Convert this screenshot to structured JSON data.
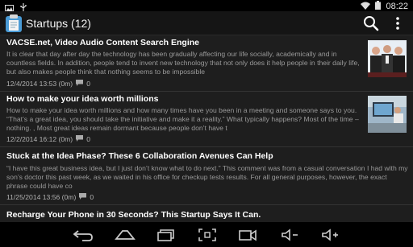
{
  "status_bar": {
    "time": "08:22",
    "left_icons": [
      "image-icon",
      "usb-icon"
    ],
    "right_icons": [
      "wifi-icon",
      "battery-icon"
    ]
  },
  "action_bar": {
    "title": "Startups (12)",
    "icons": [
      "app-logo-icon",
      "search-icon",
      "overflow-menu-icon"
    ]
  },
  "articles": [
    {
      "title": "VACSE.net, Video Audio Content Search Engine",
      "excerpt": "It is clear that day after day the technology has been gradually affecting our life socially, academically and in countless fields. In addition, people tend to invent new technology that not only does it help people in their daily life, but also makes people think that nothing seems to be impossible",
      "date": "12/4/2014 13:53 (0m)",
      "comments": "0",
      "thumbnail": "group-photo-thumbnail"
    },
    {
      "title": "How to make your idea worth millions",
      "excerpt": "How to make your idea worth millions and how many times have you been in a meeting and someone says to you. “That’s a great idea, you should take the initiative and make it a reality.” What typically happens? Most of the time – nothing. , Most great ideas remain dormant because people don’t have t",
      "date": "12/2/2014 16:12 (0m)",
      "comments": "0",
      "thumbnail": "office-thumbnail"
    },
    {
      "title": "Stuck at the Idea Phase? These 6 Collaboration Avenues Can Help",
      "excerpt": "“I have this great business idea, but I just don’t know what to do next.” This comment was from a casual conversation I had with my son’s doctor this past week, as we waited in his office for checkup tests results. For all general purposes, however, the exact phrase could have co",
      "date": "11/25/2014 13:56 (0m)",
      "comments": "0"
    },
    {
      "title": "Recharge Your Phone in 30 Seconds? This Startup Says It Can."
    }
  ],
  "nav_bar": {
    "buttons": [
      "back-icon",
      "home-icon",
      "recents-icon",
      "screenshot-icon",
      "camera-icon",
      "volume-down-icon",
      "volume-up-icon"
    ]
  }
}
